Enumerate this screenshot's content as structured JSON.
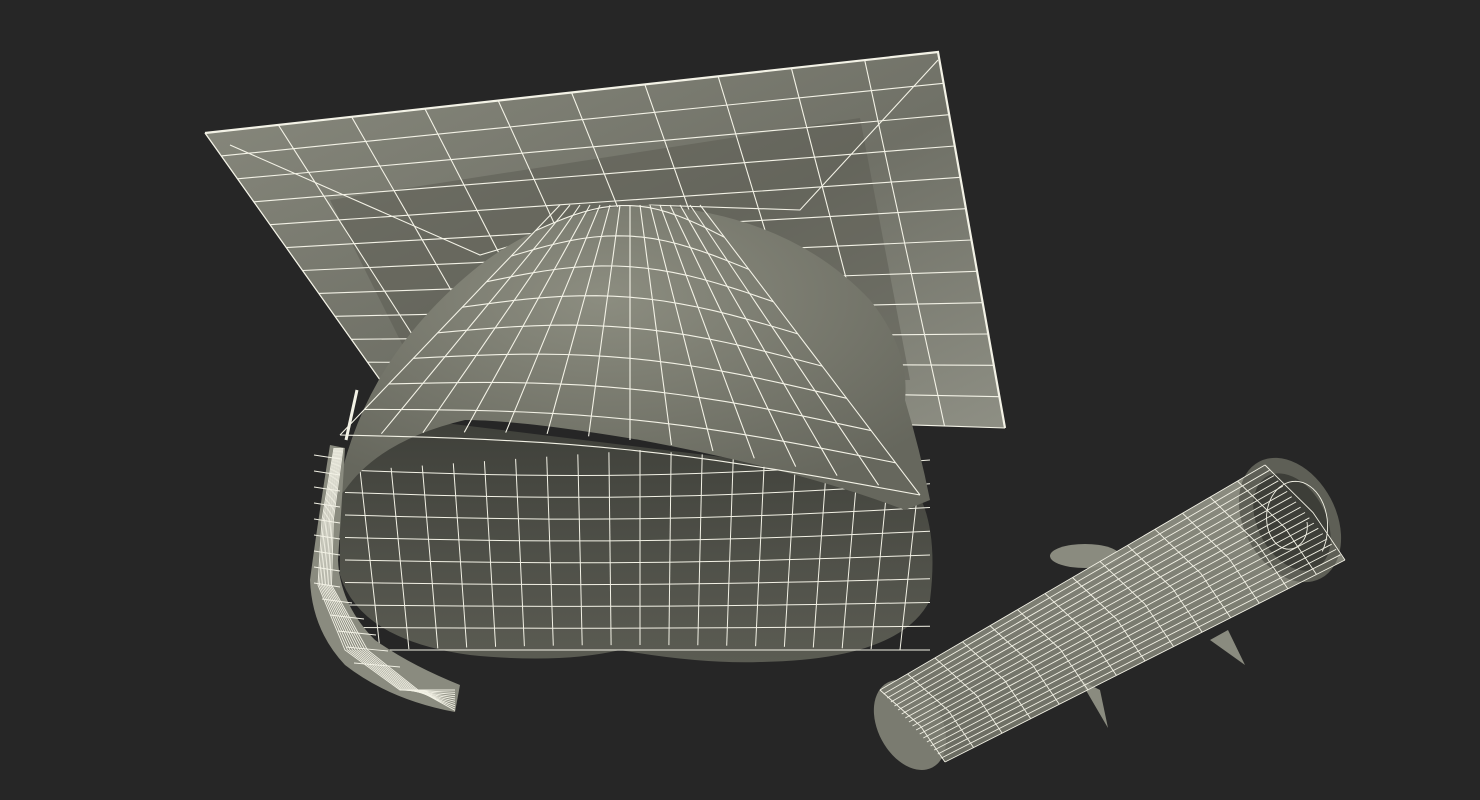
{
  "scene": {
    "background_color": "#262626",
    "surface_color": "#7d7e72",
    "surface_dark": "#55574d",
    "wire_color": "#f3f2e6",
    "objects": [
      "graduation-cap",
      "tassel",
      "diploma-scroll"
    ]
  }
}
